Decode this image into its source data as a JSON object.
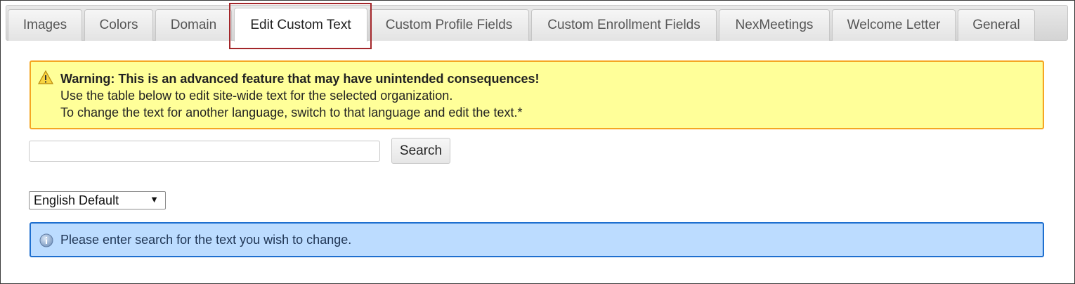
{
  "tabs": [
    {
      "label": "Images"
    },
    {
      "label": "Colors"
    },
    {
      "label": "Domain"
    },
    {
      "label": "Edit Custom Text",
      "active": true
    },
    {
      "label": "Custom Profile Fields"
    },
    {
      "label": "Custom Enrollment Fields"
    },
    {
      "label": "NexMeetings"
    },
    {
      "label": "Welcome Letter"
    },
    {
      "label": "General"
    }
  ],
  "warning": {
    "icon": "warning-triangle-icon",
    "title": "Warning: This is an advanced feature that may have unintended consequences!",
    "line1": "Use the table below to edit site-wide text for the selected organization.",
    "line2": "To change the text for another language, switch to that language and edit the text.*"
  },
  "search": {
    "value": "",
    "placeholder": "",
    "button_label": "Search"
  },
  "language_select": {
    "selected": "English Default",
    "icon": "dropdown-arrow-icon"
  },
  "info": {
    "icon": "info-icon",
    "message": "Please enter search for the text you wish to change."
  },
  "colors": {
    "warning_bg": "#ffff99",
    "warning_border": "#f5a623",
    "info_bg": "#bcdcff",
    "info_border": "#1e6fcf",
    "active_tab_highlight": "#a3262a"
  }
}
